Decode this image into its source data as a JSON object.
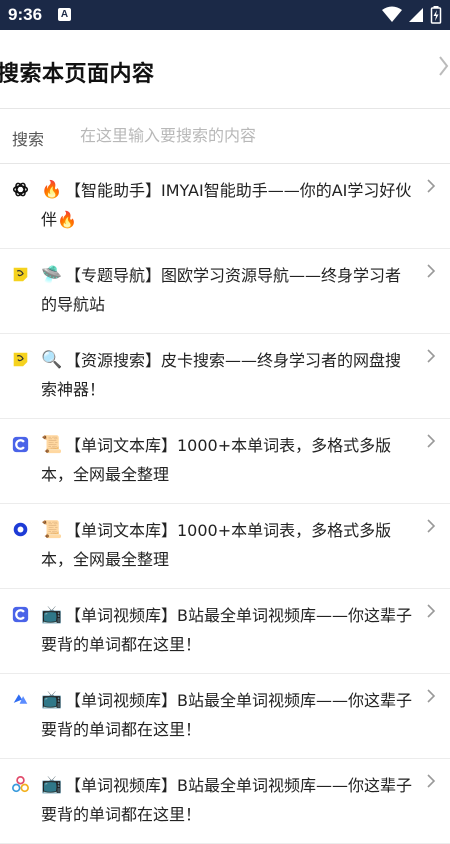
{
  "status_bar": {
    "time": "9:36",
    "app_indicator": "A",
    "icons": [
      "wifi-icon",
      "signal-icon",
      "battery-icon"
    ]
  },
  "header": {
    "title": "搜索本页面内容",
    "chevron_icon": "chevron-right-icon"
  },
  "search": {
    "label": "搜索",
    "placeholder": "在这里输入要搜索的内容",
    "value": ""
  },
  "items": [
    {
      "icon": "openai-logo-icon",
      "emoji": "🔥",
      "text": "【智能助手】IMYAI智能助手——你的AI学习好伙伴",
      "trail": "🔥",
      "icon_color": "#111111"
    },
    {
      "icon": "sticky-note-icon",
      "emoji": "🛸",
      "text": "【专题导航】图欧学习资源导航——终身学习者的导航站",
      "trail": "",
      "icon_color": "#f5d21e"
    },
    {
      "icon": "sticky-note-icon",
      "emoji": "🔍",
      "text": "【资源搜索】皮卡搜索——终身学习者的网盘搜索神器！",
      "trail": "",
      "icon_color": "#f5d21e"
    },
    {
      "icon": "blue-c-logo-icon",
      "emoji": "📜",
      "text": "【单词文本库】1000+本单词表，多格式多版本，全网最全整理",
      "trail": "",
      "icon_color": "#4a63e8"
    },
    {
      "icon": "blue-ring-icon",
      "emoji": "📜",
      "text": "【单词文本库】1000+本单词表，多格式多版本，全网最全整理",
      "trail": "",
      "icon_color": "#1d3bd6"
    },
    {
      "icon": "blue-c-logo-icon",
      "emoji": "📺",
      "text": "【单词视频库】B站最全单词视频库——你这辈子要背的单词都在这里！",
      "trail": "",
      "icon_color": "#4a63e8"
    },
    {
      "icon": "cloud-drive-icon",
      "emoji": "📺",
      "text": "【单词视频库】B站最全单词视频库——你这辈子要背的单词都在这里！",
      "trail": "",
      "icon_color": "#2f6df2"
    },
    {
      "icon": "colorful-cluster-icon",
      "emoji": "📺",
      "text": "【单词视频库】B站最全单词视频库——你这辈子要背的单词都在这里！",
      "trail": "",
      "icon_color": "#3a9bdc"
    }
  ]
}
